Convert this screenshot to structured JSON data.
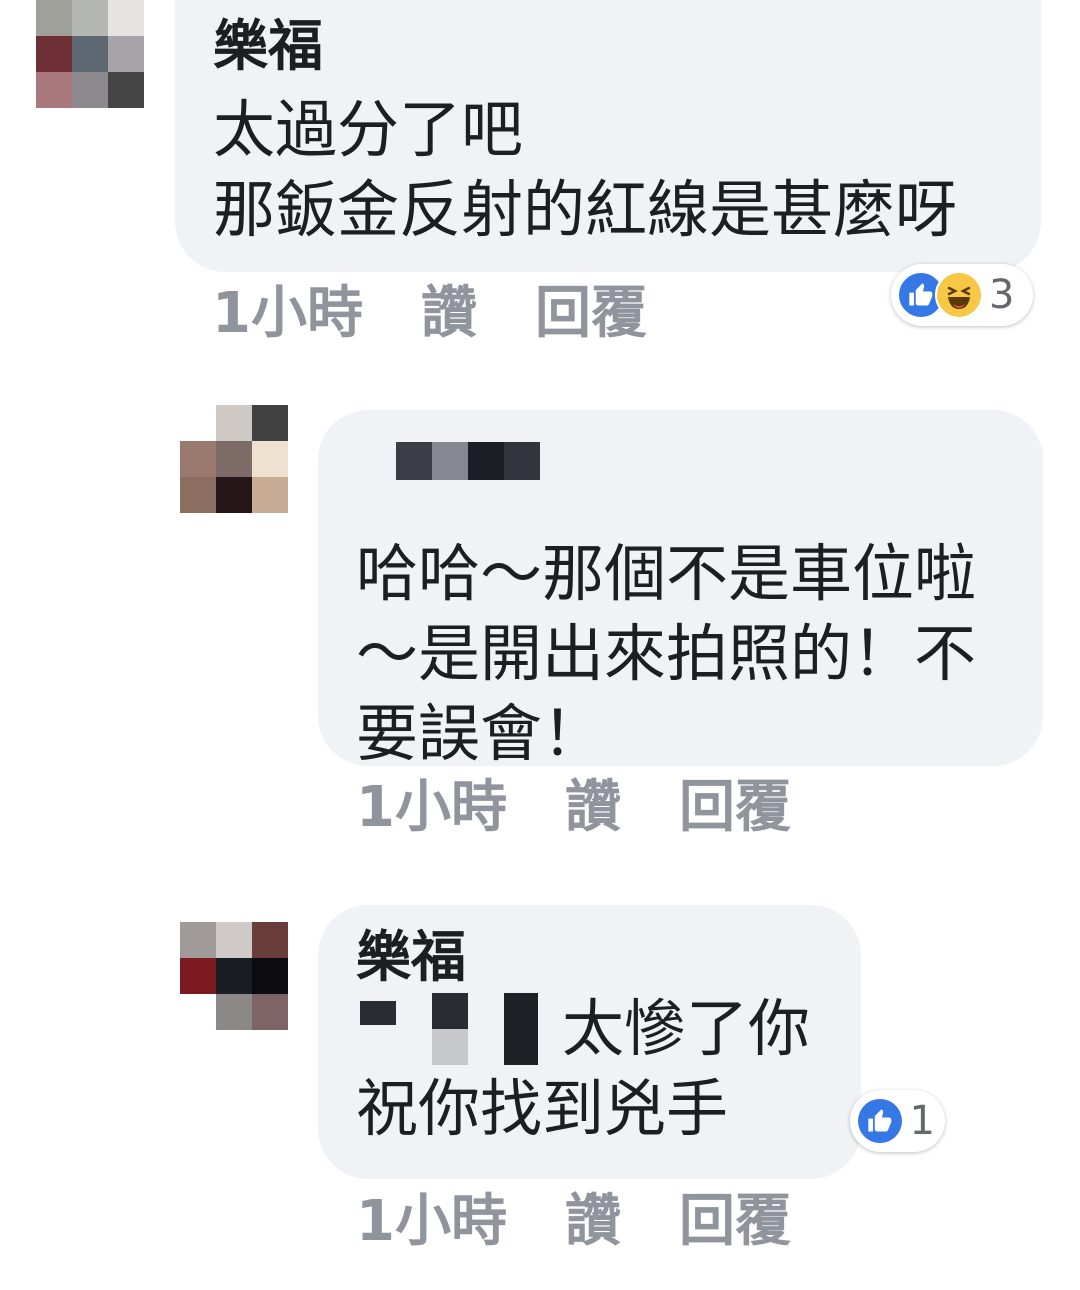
{
  "comments": [
    {
      "author": "樂福",
      "lines": [
        "太過分了吧",
        "那鈑金反射的紅線是甚麼呀"
      ],
      "meta": {
        "time": "1小時",
        "like": "讚",
        "reply": "回覆"
      },
      "reactions": {
        "icons": [
          "like-icon",
          "haha-icon"
        ],
        "count": "3"
      }
    },
    {
      "author": "",
      "lines": [
        "哈哈～那個不是車位啦",
        "～是開出來拍照的！不",
        "要誤會！"
      ],
      "meta": {
        "time": "1小時",
        "like": "讚",
        "reply": "回覆"
      }
    },
    {
      "author": "樂福",
      "lines": [
        "太慘了你",
        "祝你找到兇手"
      ],
      "meta": {
        "time": "1小時",
        "like": "讚",
        "reply": "回覆"
      },
      "reactions": {
        "icons": [
          "like-icon"
        ],
        "count": "1"
      }
    }
  ],
  "colors": {
    "bubble": "#f0f2f5",
    "meta_text": "#90949c",
    "like_blue": "#3578e5",
    "haha_yellow": "#f7c845"
  }
}
